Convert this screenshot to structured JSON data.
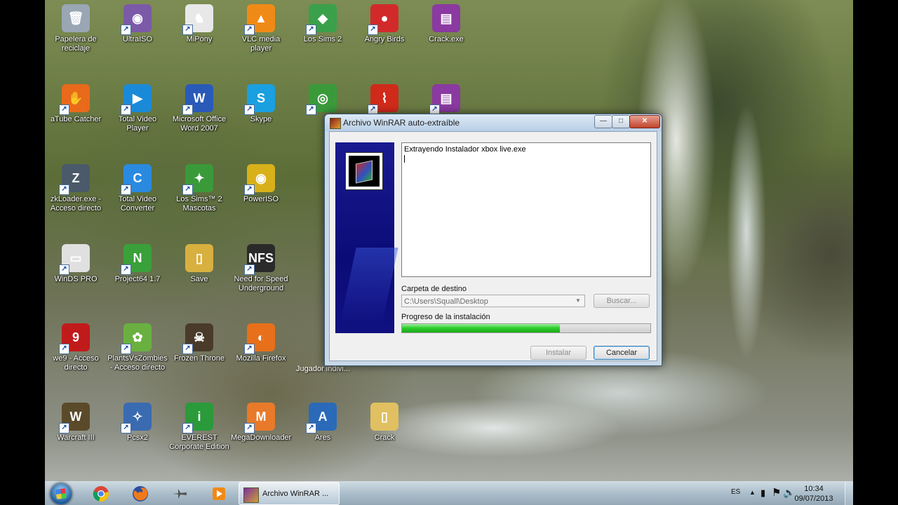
{
  "desktop": {
    "icons": [
      {
        "label": "Papelera de reciclaje",
        "color": "#9aa6b4",
        "glyph": "🗑",
        "shortcut": false
      },
      {
        "label": "UltraISO",
        "color": "#7b5aa8",
        "glyph": "◉",
        "shortcut": true
      },
      {
        "label": "MiPony",
        "color": "#e8e8e8",
        "glyph": "♞",
        "shortcut": true
      },
      {
        "label": "VLC media player",
        "color": "#f08a16",
        "glyph": "▲",
        "shortcut": true
      },
      {
        "label": "Los Sims 2",
        "color": "#3aa04a",
        "glyph": "◆",
        "shortcut": true
      },
      {
        "label": "Angry Birds",
        "color": "#d22a2a",
        "glyph": "●",
        "shortcut": true
      },
      {
        "label": "Crack.exe",
        "color": "#8a3aa0",
        "glyph": "▤",
        "shortcut": false
      },
      {
        "label": "aTube Catcher",
        "color": "#e86a1a",
        "glyph": "✋",
        "shortcut": true
      },
      {
        "label": "Total Video Player",
        "color": "#1a8ad8",
        "glyph": "▶",
        "shortcut": true
      },
      {
        "label": "Microsoft Office Word 2007",
        "color": "#2a5ab8",
        "glyph": "W",
        "shortcut": true
      },
      {
        "label": "Skype",
        "color": "#1aa0e0",
        "glyph": "S",
        "shortcut": true
      },
      {
        "label": "",
        "color": "#3a9a3a",
        "glyph": "◎",
        "shortcut": true
      },
      {
        "label": "",
        "color": "#d02a1a",
        "glyph": "⌇",
        "shortcut": true
      },
      {
        "label": "",
        "color": "#8a3aa0",
        "glyph": "▤",
        "shortcut": true
      },
      {
        "label": "zkLoader.exe - Acceso directo",
        "color": "#4a5a6a",
        "glyph": "Z",
        "shortcut": true
      },
      {
        "label": "Total Video Converter",
        "color": "#2a8ae0",
        "glyph": "C",
        "shortcut": true
      },
      {
        "label": "Los Sims™ 2 Mascotas",
        "color": "#3a9a3a",
        "glyph": "✦",
        "shortcut": true
      },
      {
        "label": "PowerISO",
        "color": "#d8b01a",
        "glyph": "◉",
        "shortcut": true
      },
      {
        "label": "WinDS PRO",
        "color": "#e0e0e0",
        "glyph": "▭",
        "shortcut": true
      },
      {
        "label": "Project64 1.7",
        "color": "#3aa03a",
        "glyph": "N",
        "shortcut": true
      },
      {
        "label": "Save",
        "color": "#d8b040",
        "glyph": "▯",
        "shortcut": false
      },
      {
        "label": "Need for Speed Underground",
        "color": "#2a2a2a",
        "glyph": "NFS",
        "shortcut": true
      },
      {
        "label": "we9 - Acceso directo",
        "color": "#c01a1a",
        "glyph": "9",
        "shortcut": true
      },
      {
        "label": "PlantsVsZombies - Acceso directo",
        "color": "#6ab040",
        "glyph": "✿",
        "shortcut": true
      },
      {
        "label": "Frozen Throne",
        "color": "#4a3a2a",
        "glyph": "☠",
        "shortcut": true
      },
      {
        "label": "Mozilla Firefox",
        "color": "#e8701a",
        "glyph": "◐",
        "shortcut": true
      },
      {
        "label": "Warcraft III",
        "color": "#5a4a2a",
        "glyph": "W",
        "shortcut": true
      },
      {
        "label": "Pcsx2",
        "color": "#3a6ab0",
        "glyph": "✧",
        "shortcut": true
      },
      {
        "label": "EVEREST Corporate Edition",
        "color": "#2a9a3a",
        "glyph": "i",
        "shortcut": true
      },
      {
        "label": "MegaDownloader",
        "color": "#e87a2a",
        "glyph": "M",
        "shortcut": true
      },
      {
        "label": "Ares",
        "color": "#2a6ab8",
        "glyph": "A",
        "shortcut": true
      },
      {
        "label": "Crack",
        "color": "#e0c060",
        "glyph": "▯",
        "shortcut": false
      }
    ],
    "hidden_label": "Jugador indivi..."
  },
  "dialog": {
    "title": "Archivo WinRAR auto-extraíble",
    "minimize": "—",
    "maximize": "□",
    "close": "✕",
    "log_text": "Extrayendo Instalador xbox live.exe",
    "dest_label": "Carpeta de destino",
    "dest_value": "C:\\Users\\Squall\\Desktop",
    "browse_button": "Buscar...",
    "progress_label": "Progreso de la instalación",
    "progress_fraction": 0.635,
    "install_button": "Instalar",
    "cancel_button": "Cancelar"
  },
  "taskbar": {
    "pinned": [
      "start-orb",
      "chrome-icon",
      "firefox-icon",
      "aircraft-icon",
      "media-player-icon"
    ],
    "task_label": "Archivo WinRAR ...",
    "language": "ES",
    "time": "10:34",
    "date": "09/07/2013"
  }
}
